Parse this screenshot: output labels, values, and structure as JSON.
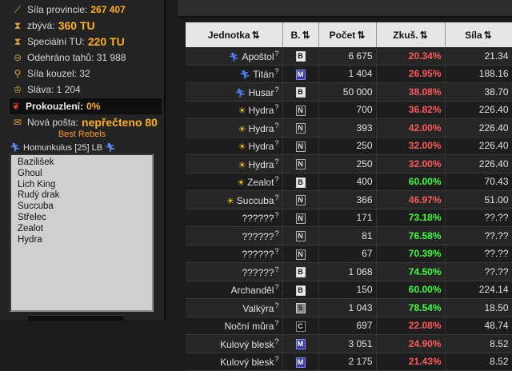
{
  "sidebar": {
    "stats": [
      {
        "icon": "sword-icon",
        "label": "Síla provincie:",
        "value": "267 407"
      },
      {
        "icon": "hourglass-icon",
        "label": "zbývá:",
        "value": "360 TU"
      },
      {
        "icon": "hourglass-icon",
        "label": "Speciální TU:",
        "value": "220 TU"
      },
      {
        "icon": "turns-icon",
        "label": "Odehráno tahů: 31 988",
        "value": ""
      },
      {
        "icon": "wand-icon",
        "label": "Síla kouzel: 32",
        "value": ""
      },
      {
        "icon": "fame-icon",
        "label": "Sláva: 1 204",
        "value": ""
      },
      {
        "icon": "leaf-icon",
        "label": "Prokouzlení:",
        "value": "0%"
      },
      {
        "icon": "envelope-icon",
        "label": "Nová pošta:",
        "value": "nepřečteno 80"
      }
    ],
    "best_rebels": "Best Rebels",
    "homunkulus": "Homunkulus [25] LB",
    "list": [
      "Bazilišek",
      "Ghoul",
      "Lich King",
      "Rudý drak",
      "Succuba",
      "Střelec",
      "Zealot",
      "Hydra"
    ]
  },
  "table": {
    "headers": {
      "unit": "Jednotka",
      "b": "B.",
      "count": "Počet",
      "exp": "Zkuš.",
      "power": "Síla"
    },
    "sort_glyph": "⇅",
    "rows": [
      {
        "icon": "runner-icon",
        "name": "Apoštol",
        "b": "B",
        "count": "6 675",
        "exp": "20.34%",
        "color": "#ff5a5a",
        "power": "21.34"
      },
      {
        "icon": "runner-icon",
        "name": "Titán",
        "b": "M",
        "count": "1 404",
        "exp": "26.95%",
        "color": "#ff5a5a",
        "power": "188.16"
      },
      {
        "icon": "runner-icon",
        "name": "Husar",
        "b": "B",
        "count": "50 000",
        "exp": "38.08%",
        "color": "#ff5a5a",
        "power": "38.70"
      },
      {
        "icon": "sun-icon",
        "name": "Hydra",
        "b": "N",
        "count": "700",
        "exp": "36.82%",
        "color": "#ff5a5a",
        "power": "226.40"
      },
      {
        "icon": "sun-icon",
        "name": "Hydra",
        "b": "N",
        "count": "393",
        "exp": "42.00%",
        "color": "#ff5a5a",
        "power": "226.40"
      },
      {
        "icon": "sun-icon",
        "name": "Hydra",
        "b": "N",
        "count": "250",
        "exp": "32.00%",
        "color": "#ff5a5a",
        "power": "226.40"
      },
      {
        "icon": "sun-icon",
        "name": "Hydra",
        "b": "N",
        "count": "250",
        "exp": "32.00%",
        "color": "#ff5a5a",
        "power": "226.40"
      },
      {
        "icon": "sun-icon",
        "name": "Zealot",
        "b": "B",
        "count": "400",
        "exp": "60.00%",
        "color": "#3dff3d",
        "power": "70.43"
      },
      {
        "icon": "sun-icon",
        "name": "Succuba",
        "b": "N",
        "count": "366",
        "exp": "46.97%",
        "color": "#ff5a5a",
        "power": "51.00"
      },
      {
        "icon": "",
        "name": "??????",
        "b": "N",
        "count": "171",
        "exp": "73.18%",
        "color": "#3dff3d",
        "power": "??.??"
      },
      {
        "icon": "",
        "name": "??????",
        "b": "N",
        "count": "81",
        "exp": "76.58%",
        "color": "#3dff3d",
        "power": "??.??"
      },
      {
        "icon": "",
        "name": "??????",
        "b": "N",
        "count": "67",
        "exp": "70.39%",
        "color": "#3dff3d",
        "power": "??.??"
      },
      {
        "icon": "",
        "name": "??????",
        "b": "B",
        "count": "1 068",
        "exp": "74.50%",
        "color": "#3dff3d",
        "power": "??.??"
      },
      {
        "icon": "",
        "name": "Archanděl",
        "b": "B",
        "count": "150",
        "exp": "60.00%",
        "color": "#3dff3d",
        "power": "224.14"
      },
      {
        "icon": "",
        "name": "Valkýra",
        "b": "S",
        "count": "1 043",
        "exp": "78.54%",
        "color": "#3dff3d",
        "power": "18.50"
      },
      {
        "icon": "",
        "name": "Noční můra",
        "b": "C",
        "count": "697",
        "exp": "22.08%",
        "color": "#ff5a5a",
        "power": "48.74"
      },
      {
        "icon": "",
        "name": "Kulový blesk",
        "b": "M",
        "count": "3 051",
        "exp": "24.90%",
        "color": "#ff5a5a",
        "power": "8.52"
      },
      {
        "icon": "",
        "name": "Kulový blesk",
        "b": "M",
        "count": "2 175",
        "exp": "21.43%",
        "color": "#ff5a5a",
        "power": "8.52"
      }
    ]
  }
}
